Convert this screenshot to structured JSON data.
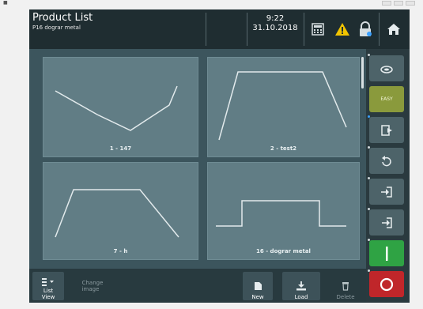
{
  "header": {
    "title": "Product List",
    "subtitle": "P16 dograr metal",
    "time": "9:22",
    "date": "31.10.2018"
  },
  "products": [
    {
      "label": "1 - 147"
    },
    {
      "label": "2 - test2"
    },
    {
      "label": "7 - h"
    },
    {
      "label": "16 - dograr metal"
    }
  ],
  "rail": {
    "easy_label": "EASY"
  },
  "bottom": {
    "list_view_label": "List\nView",
    "change_image_label": "Change\nimage",
    "new_label": "New",
    "load_label": "Load",
    "delete_label": "Delete"
  },
  "colors": {
    "header_bg": "#1f2d31",
    "app_bg": "#3c555d",
    "panel_bg": "#617d85",
    "rail_bg": "#2a3a3f",
    "easy_green": "#8a9a3c",
    "start_green": "#2fa344",
    "stop_red": "#c0262a",
    "warning_yellow": "#f2c400"
  },
  "icons": [
    "calculator-icon",
    "warning-icon",
    "lock-icon",
    "home-icon",
    "cloud-icon",
    "step-icon",
    "rotate-icon",
    "import-icon",
    "export-icon",
    "start-icon",
    "stop-icon",
    "list-view-icon",
    "new-icon",
    "load-icon",
    "delete-icon"
  ]
}
